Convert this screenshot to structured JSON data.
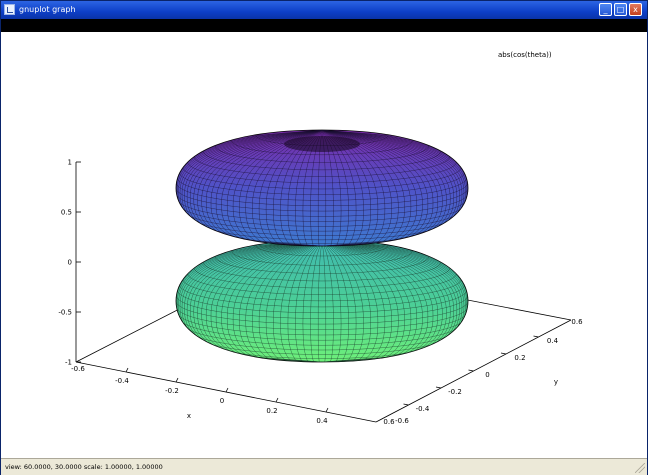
{
  "window": {
    "title": "gnuplot graph",
    "controls": {
      "minimize": "_",
      "maximize": "□",
      "close": "x"
    }
  },
  "status": {
    "text": "view: 60.0000, 30.0000   scale: 1.00000, 1.00000"
  },
  "chart_data": {
    "type": "surface3d",
    "title": "",
    "key": "abs(cos(theta))",
    "view": {
      "rot_x": 60,
      "rot_z": 30,
      "scale": 1.0,
      "scale_z": 1.0
    },
    "surface": "r = |cos(theta)| spherical surface (double lobe), coloured by height",
    "colors": {
      "low": "#6ef07a",
      "mid": "#3fb8b0",
      "high": "#7a2aa8"
    },
    "xlabel": "x",
    "ylabel": "y",
    "zlabel": "",
    "x_ticks": [
      "-0.4",
      "-0.2",
      "0",
      "0.2",
      "0.4"
    ],
    "x_corner_labels": [
      "-0.6",
      "0.6"
    ],
    "y_ticks": [
      "-0.4",
      "-0.2",
      "0",
      "0.2",
      "0.4"
    ],
    "y_corner_labels": [
      "-0.6",
      "0.6"
    ],
    "z_ticks": [
      "-1",
      "-0.5",
      "0",
      "0.5",
      "1"
    ],
    "xrange": [
      -0.6,
      0.6
    ],
    "yrange": [
      -0.6,
      0.6
    ],
    "zrange": [
      -1,
      1
    ]
  }
}
